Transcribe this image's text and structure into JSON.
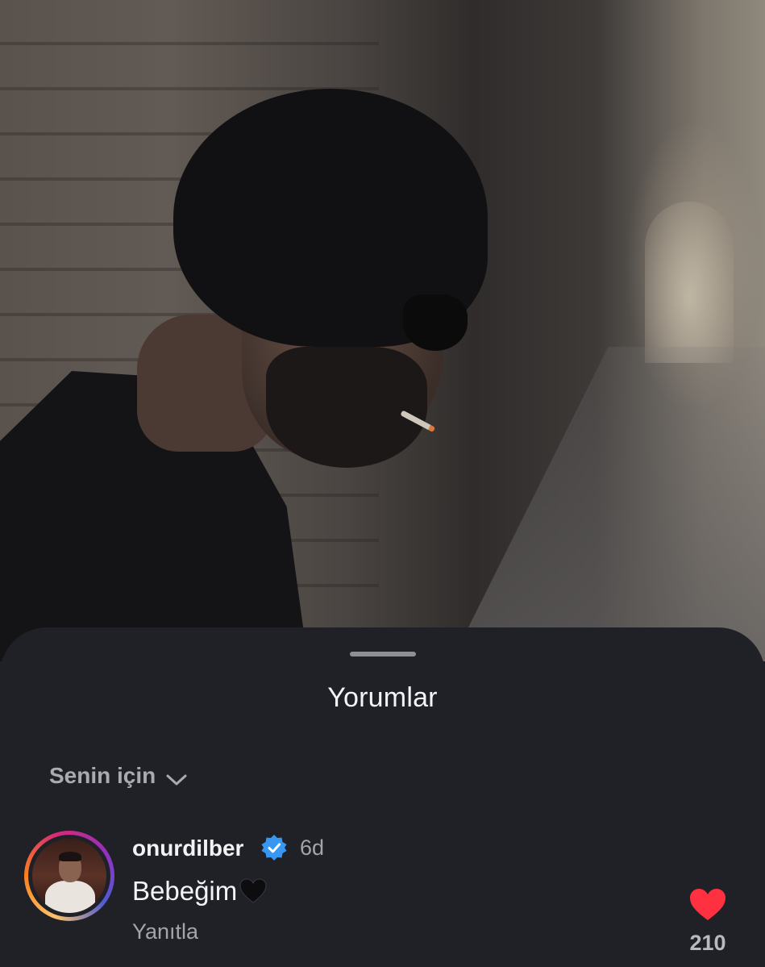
{
  "sheet": {
    "title": "Yorumlar",
    "sort_label": "Senin için"
  },
  "comment": {
    "username": "onurdilber",
    "time": "6d",
    "text": "Bebeğim",
    "reply_label": "Yanıtla",
    "like_count": "210"
  },
  "icons": {
    "sort": "chevron-down-icon",
    "verified": "verified-badge-icon",
    "emoji": "black-heart-emoji",
    "like": "heart-icon"
  },
  "colors": {
    "sheet_background": "#202127",
    "verified_blue": "#3897f0",
    "like_red": "#ff3040"
  }
}
